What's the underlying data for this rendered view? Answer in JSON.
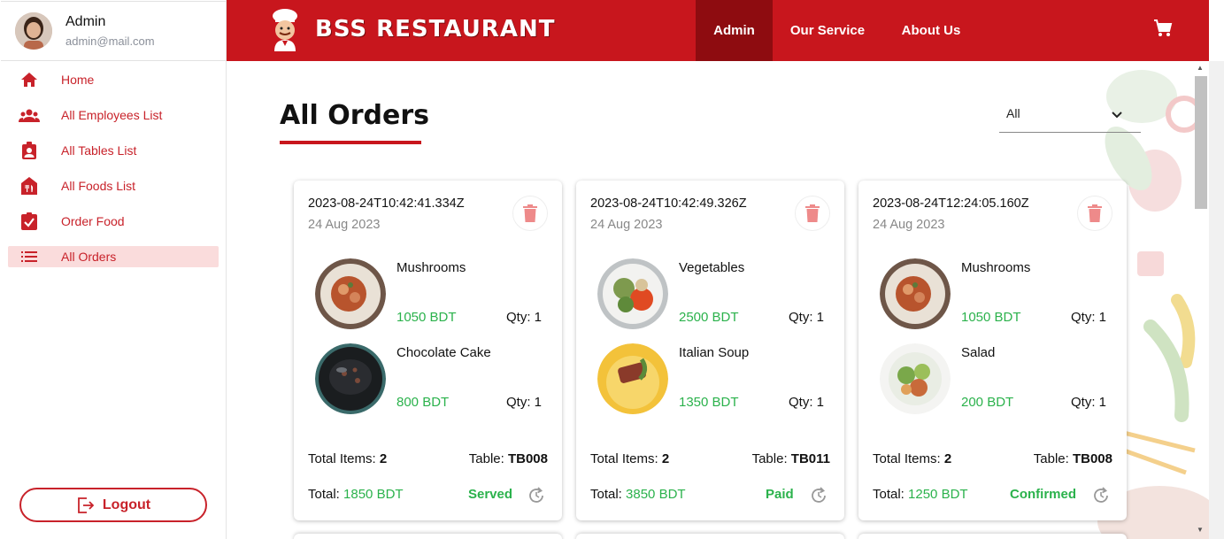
{
  "profile": {
    "name": "Admin",
    "email": "admin@mail.com"
  },
  "sidebar": {
    "items": [
      {
        "label": "Home",
        "icon": "home-icon"
      },
      {
        "label": "All Employees List",
        "icon": "people-icon"
      },
      {
        "label": "All Tables List",
        "icon": "badge-icon"
      },
      {
        "label": "All Foods List",
        "icon": "restaurant-icon"
      },
      {
        "label": "Order Food",
        "icon": "clipboard-check-icon"
      },
      {
        "label": "All Orders",
        "icon": "list-icon",
        "active": true
      }
    ],
    "logout_label": "Logout"
  },
  "header": {
    "brand": "BSS RESTAURANT",
    "nav": [
      "Admin",
      "Our Service",
      "About Us"
    ],
    "active_nav": "Admin",
    "cart_icon": "cart-icon"
  },
  "main": {
    "title": "All Orders",
    "filter": {
      "value": "All"
    }
  },
  "orders": [
    {
      "stamp": "2023-08-24T10:42:41.334Z",
      "date": "24 Aug 2023",
      "items": [
        {
          "name": "Mushrooms",
          "price": "1050 BDT",
          "qty": "Qty: 1"
        },
        {
          "name": "Chocolate Cake",
          "price": "800 BDT",
          "qty": "Qty: 1"
        }
      ],
      "total_items_label": "Total Items:",
      "total_items": "2",
      "table_label": "Table:",
      "table": "TB008",
      "total_label": "Total:",
      "total": "1850 BDT",
      "status": "Served"
    },
    {
      "stamp": "2023-08-24T10:42:49.326Z",
      "date": "24 Aug 2023",
      "items": [
        {
          "name": "Vegetables",
          "price": "2500 BDT",
          "qty": "Qty: 1"
        },
        {
          "name": "Italian Soup",
          "price": "1350 BDT",
          "qty": "Qty: 1"
        }
      ],
      "total_items_label": "Total Items:",
      "total_items": "2",
      "table_label": "Table:",
      "table": "TB011",
      "total_label": "Total:",
      "total": "3850 BDT",
      "status": "Paid"
    },
    {
      "stamp": "2023-08-24T12:24:05.160Z",
      "date": "24 Aug 2023",
      "items": [
        {
          "name": "Mushrooms",
          "price": "1050 BDT",
          "qty": "Qty: 1"
        },
        {
          "name": "Salad",
          "price": "200 BDT",
          "qty": "Qty: 1"
        }
      ],
      "total_items_label": "Total Items:",
      "total_items": "2",
      "table_label": "Table:",
      "table": "TB008",
      "total_label": "Total:",
      "total": "1250 BDT",
      "status": "Confirmed"
    }
  ],
  "colors": {
    "brand_red": "#c8161d",
    "active_nav": "#8e0c10",
    "accent_green": "#2bb24c",
    "sidebar_active": "#fadcdc"
  }
}
